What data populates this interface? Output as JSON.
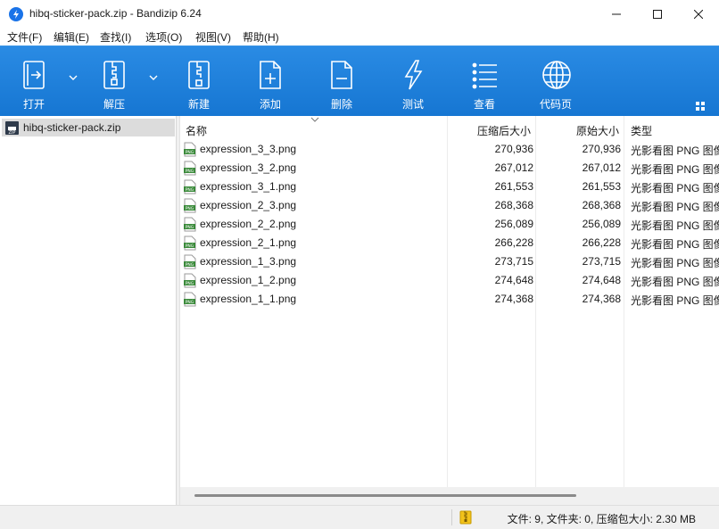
{
  "window": {
    "title": "hibq-sticker-pack.zip - Bandizip 6.24",
    "app_icon": "bandizip-logo-icon",
    "controls": [
      "minimize-icon",
      "maximize-icon",
      "close-icon"
    ]
  },
  "menu": [
    "文件(F)",
    "编辑(E)",
    "查找(I)",
    "选项(O)",
    "视图(V)",
    "帮助(H)"
  ],
  "toolbar": {
    "color": "#1e7fdb",
    "buttons": [
      {
        "label": "打开",
        "icon": "open-archive-icon",
        "has_dropdown": true
      },
      {
        "label": "解压",
        "icon": "extract-icon",
        "has_dropdown": true
      },
      {
        "label": "新建",
        "icon": "new-archive-icon",
        "has_dropdown": false
      },
      {
        "label": "添加",
        "icon": "add-file-icon",
        "has_dropdown": false
      },
      {
        "label": "删除",
        "icon": "delete-file-icon",
        "has_dropdown": false
      },
      {
        "label": "测试",
        "icon": "test-lightning-icon",
        "has_dropdown": false
      },
      {
        "label": "查看",
        "icon": "view-list-icon",
        "has_dropdown": false
      },
      {
        "label": "代码页",
        "icon": "codepage-globe-icon",
        "has_dropdown": false
      }
    ],
    "layout_icon": "layout-grid-icon"
  },
  "tree": {
    "selected_item": "hibq-sticker-pack.zip",
    "item_icon": "zip-archive-icon"
  },
  "columns": {
    "name": "名称",
    "packed": "压缩后大小",
    "original": "原始大小",
    "type": "类型"
  },
  "files": [
    {
      "name": "expression_3_3.png",
      "packed": "270,936",
      "original": "270,936",
      "type": "光影看图 PNG 图像"
    },
    {
      "name": "expression_3_2.png",
      "packed": "267,012",
      "original": "267,012",
      "type": "光影看图 PNG 图像"
    },
    {
      "name": "expression_3_1.png",
      "packed": "261,553",
      "original": "261,553",
      "type": "光影看图 PNG 图像"
    },
    {
      "name": "expression_2_3.png",
      "packed": "268,368",
      "original": "268,368",
      "type": "光影看图 PNG 图像"
    },
    {
      "name": "expression_2_2.png",
      "packed": "256,089",
      "original": "256,089",
      "type": "光影看图 PNG 图像"
    },
    {
      "name": "expression_2_1.png",
      "packed": "266,228",
      "original": "266,228",
      "type": "光影看图 PNG 图像"
    },
    {
      "name": "expression_1_3.png",
      "packed": "273,715",
      "original": "273,715",
      "type": "光影看图 PNG 图像"
    },
    {
      "name": "expression_1_2.png",
      "packed": "274,648",
      "original": "274,648",
      "type": "光影看图 PNG 图像"
    },
    {
      "name": "expression_1_1.png",
      "packed": "274,368",
      "original": "274,368",
      "type": "光影看图 PNG 图像"
    }
  ],
  "file_icon": "png-file-icon",
  "status": {
    "text": "文件: 9, 文件夹: 0, 压缩包大小: 2.30 MB",
    "icon": "archive-status-icon"
  }
}
